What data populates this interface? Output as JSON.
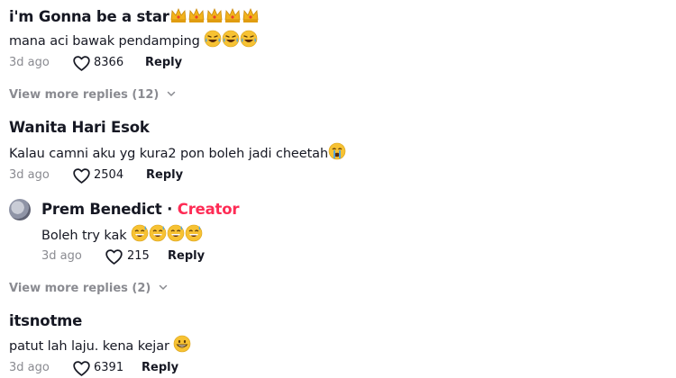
{
  "comments": [
    {
      "username": "i'm Gonna be a star",
      "username_emojis": [
        "crown-emoji",
        "crown-emoji",
        "crown-emoji",
        "crown-emoji",
        "crown-emoji"
      ],
      "text": "mana aci bawak pendamping",
      "text_emojis": [
        "laughing-tears-emoji",
        "laughing-tears-emoji",
        "laughing-tears-emoji"
      ],
      "time": "3d ago",
      "likes": "8366",
      "reply_label": "Reply",
      "view_more": "View more replies (12)"
    },
    {
      "username": "Wanita Hari Esok",
      "text": "Kalau camni aku yg kura2 pon boleh jadi cheetah",
      "text_emojis": [
        "crying-emoji"
      ],
      "time": "3d ago",
      "likes": "2504",
      "reply_label": "Reply",
      "nested_reply": {
        "username": "Prem Benedict",
        "separator": "·",
        "badge": "Creator",
        "text": "Boleh try kak",
        "text_emojis": [
          "sweat-smile-emoji",
          "sweat-smile-emoji",
          "sweat-smile-emoji",
          "sweat-smile-emoji"
        ],
        "time": "3d ago",
        "likes": "215",
        "reply_label": "Reply"
      },
      "view_more": "View more replies (2)"
    },
    {
      "username": "itsnotme",
      "text": "patut lah laju. kena kejar",
      "text_emojis": [
        "grinning-emoji"
      ],
      "time": "3d ago",
      "likes": "6391",
      "reply_label": "Reply"
    }
  ],
  "colors": {
    "accent": "#fe2c55",
    "muted": "#8a8b91",
    "text": "#161823",
    "emoji_yellow": "#f7c233"
  }
}
